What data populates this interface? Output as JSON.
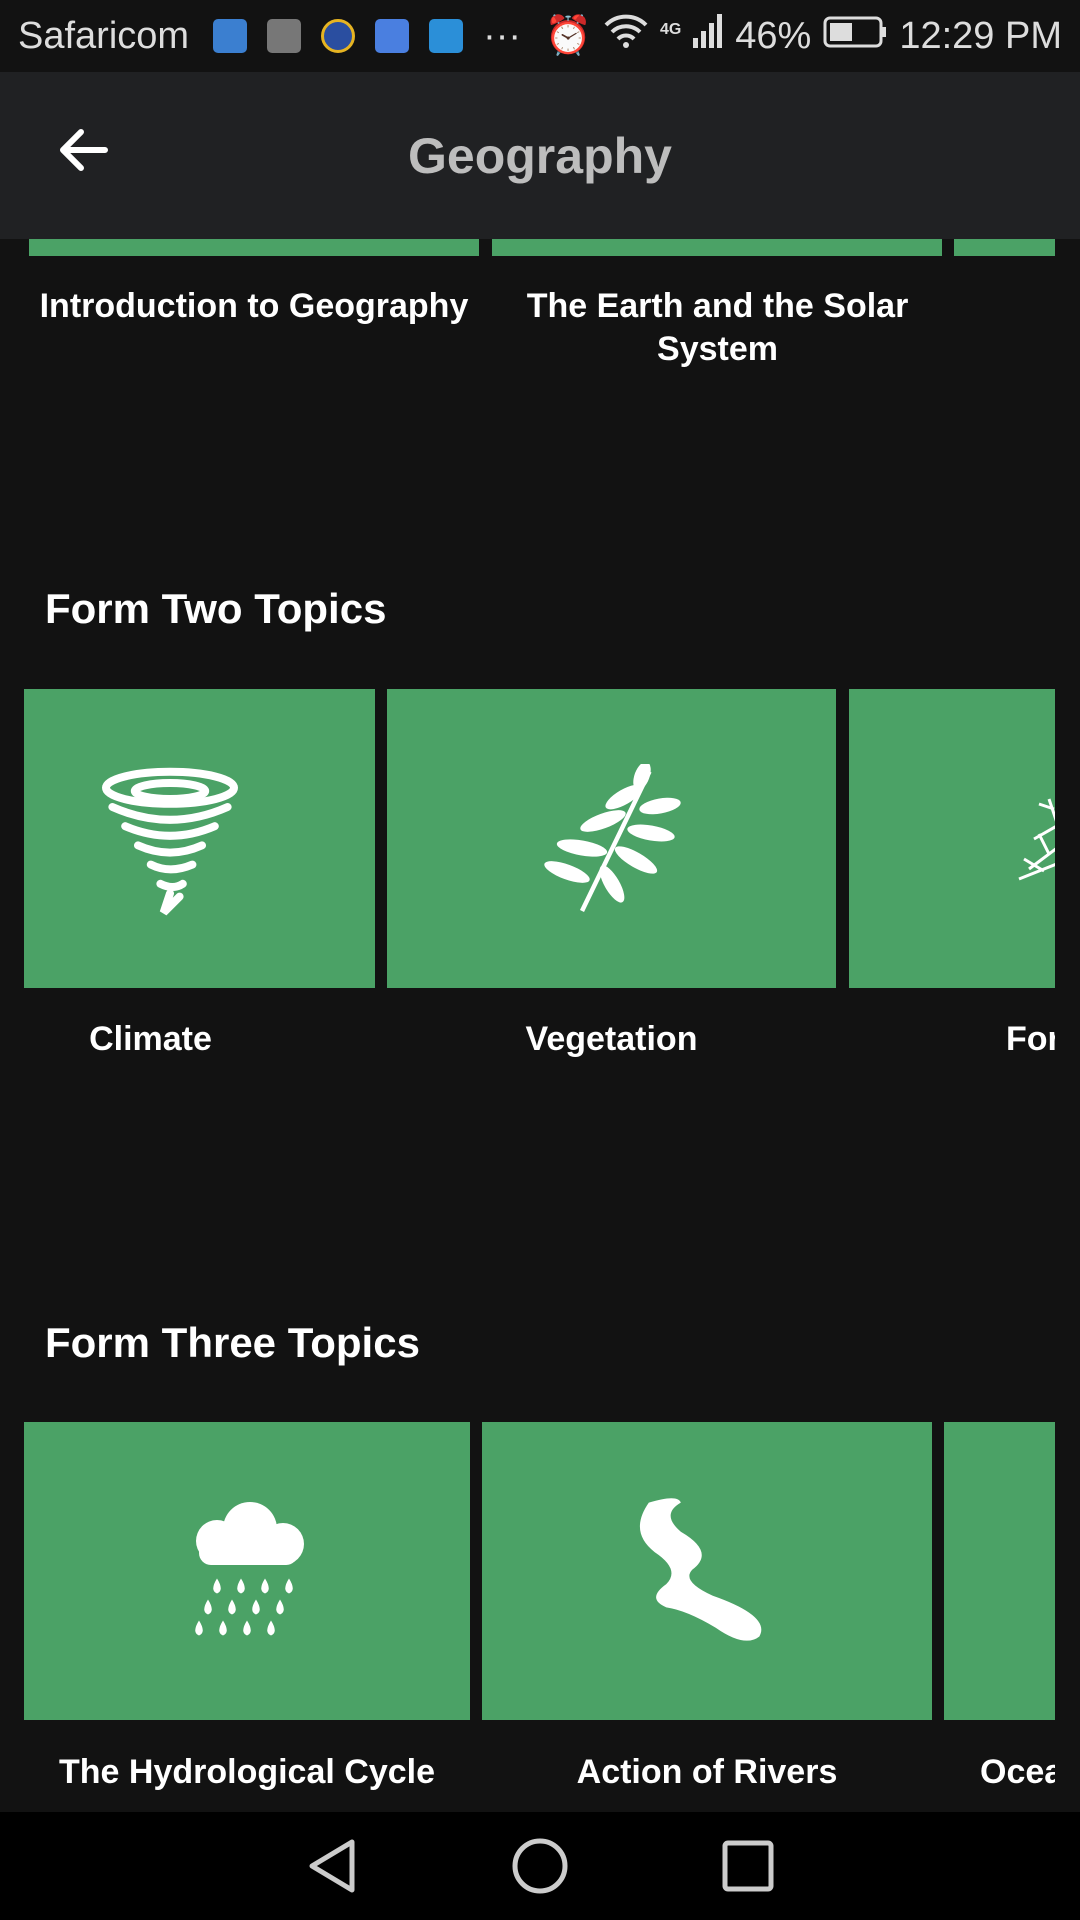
{
  "status_bar": {
    "carrier": "Safaricom",
    "more": "···",
    "network": "4G",
    "battery": "46%",
    "time": "12:29 PM",
    "battery_level": 0.46
  },
  "header": {
    "title": "Geography"
  },
  "form_one": {
    "items": [
      {
        "label": "Introduction to Geography"
      },
      {
        "label": "The Earth and the Solar System"
      },
      {
        "label": ""
      }
    ]
  },
  "form_two": {
    "title": "Form Two Topics",
    "items": [
      {
        "label": "Climate",
        "icon": "tornado-icon"
      },
      {
        "label": "Vegetation",
        "icon": "leaf-icon"
      },
      {
        "label": "For",
        "icon": "tree-icon"
      }
    ]
  },
  "form_three": {
    "title": "Form Three Topics",
    "items": [
      {
        "label": "The Hydrological Cycle",
        "icon": "rain-cloud-icon"
      },
      {
        "label": "Action of Rivers",
        "icon": "river-icon"
      },
      {
        "label": "Ocea",
        "icon": ""
      }
    ]
  },
  "colors": {
    "card": "#4ba266",
    "background": "#121212",
    "header": "#202123"
  }
}
